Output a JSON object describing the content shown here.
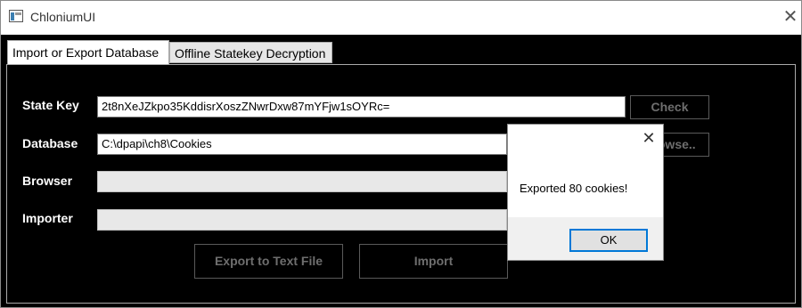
{
  "window": {
    "title": "ChloniumUI"
  },
  "tabs": [
    {
      "label": "Import or Export Database"
    },
    {
      "label": "Offline Statekey Decryption"
    }
  ],
  "form": {
    "state_key_label": "State Key",
    "state_key_value": "2t8nXeJZkpo35KddisrXoszZNwrDxw87mYFjw1sOYRc=",
    "check_button": "Check",
    "database_label": "Database",
    "database_value": "C:\\dpapi\\ch8\\Cookies",
    "browse_button": "Browse..",
    "browser_label": "Browser",
    "importer_label": "Importer",
    "export_button": "Export to Text File",
    "import_button": "Import"
  },
  "dialog": {
    "message": "Exported 80 cookies!",
    "ok_button": "OK"
  }
}
